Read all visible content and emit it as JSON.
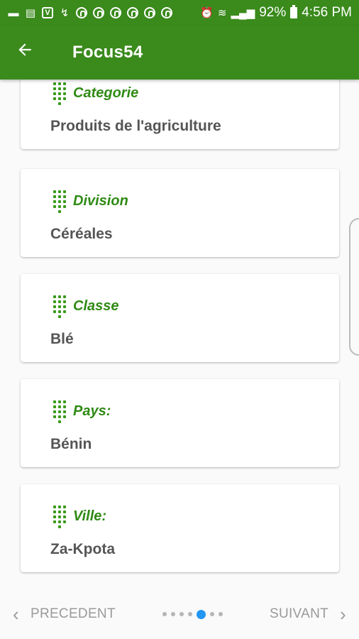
{
  "status_bar": {
    "battery": "92%",
    "time": "4:56 PM"
  },
  "app_bar": {
    "title": "Focus54"
  },
  "cards": [
    {
      "label": "Categorie",
      "value": "Produits de l'agriculture"
    },
    {
      "label": "Division",
      "value": "Céréales"
    },
    {
      "label": "Classe",
      "value": "Blé"
    },
    {
      "label": "Pays:",
      "value": "Bénin"
    },
    {
      "label": "Ville:",
      "value": "Za-Kpota"
    }
  ],
  "footer": {
    "prev_label": "PRECEDENT",
    "next_label": "SUIVANT",
    "page_count": 7,
    "current_page": 5
  },
  "colors": {
    "primary": "#3a8a1c",
    "accent_text": "#2f8a14",
    "page_indicator_active": "#2196f3"
  }
}
